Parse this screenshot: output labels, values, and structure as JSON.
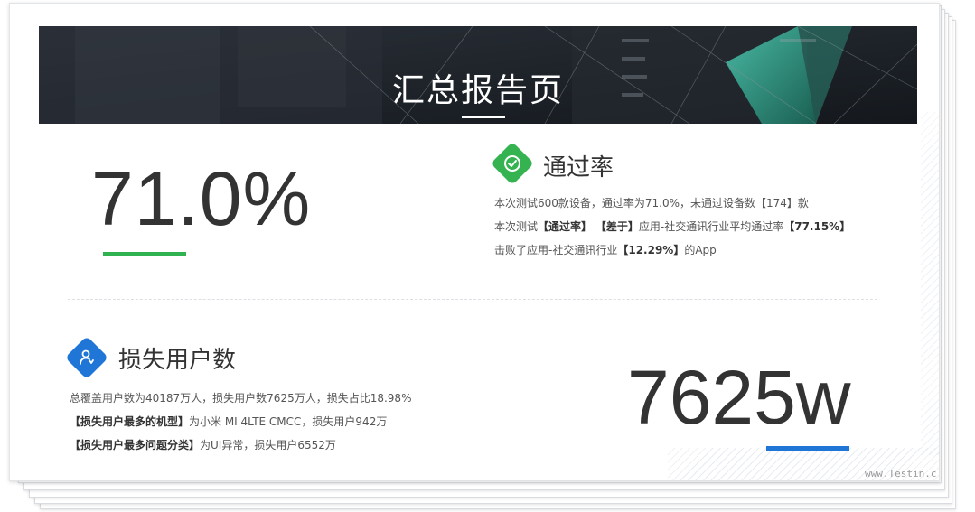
{
  "banner": {
    "title": "汇总报告页"
  },
  "pass_rate": {
    "value": "71.0%",
    "title": "通过率",
    "accent": "#2fb24f",
    "line1": "本次测试600款设备，通过率为71.0%，未通过设备数【174】款",
    "line2_pre": "本次测试",
    "line2_b1": "【通过率】",
    "line2_b2": "【差于】",
    "line2_mid": "应用-社交通讯行业平均通过率",
    "line2_b3": "【77.15%】",
    "line3_pre": "击败了应用-社交通讯行业",
    "line3_b": "【12.29%】",
    "line3_post": "的App",
    "icon": "check-shield-icon"
  },
  "lost_users": {
    "value": "7625w",
    "title": "损失用户数",
    "accent": "#1f76d6",
    "line1": "总覆盖用户数为40187万人，损失用户数7625万人，损失占比18.98%",
    "line2_b": "【损失用户最多的机型】",
    "line2_post": "为小米 MI 4LTE CMCC，损失用户942万",
    "line3_b": "【损失用户最多问题分类】",
    "line3_post": "为UI异常，损失用户6552万",
    "icon": "user-down-icon"
  },
  "watermark": "www.Testin.c"
}
